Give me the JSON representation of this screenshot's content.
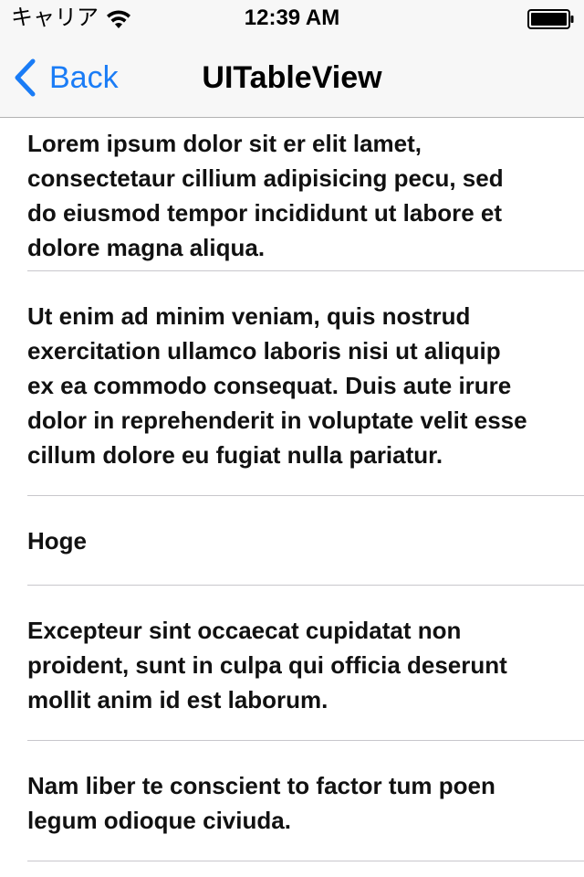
{
  "status_bar": {
    "carrier": "キャリア",
    "time": "12:39 AM",
    "wifi_icon": "wifi-icon",
    "battery_icon": "battery-full-icon"
  },
  "nav": {
    "back_label": "Back",
    "back_icon": "chevron-left-icon",
    "title": "UITableView",
    "tint_color": "#1a7cf6"
  },
  "table": {
    "rows": [
      {
        "text": "Lorem ipsum dolor sit er elit lamet,\nconsectetaur cillium adipisicing pecu, sed\ndo eiusmod tempor incididunt ut labore et\ndolore magna aliqua."
      },
      {
        "text": "Ut enim ad minim veniam, quis nostrud\nexercitation ullamco laboris nisi ut aliquip\nex ea commodo consequat. Duis aute irure\ndolor in reprehenderit in voluptate velit esse\ncillum dolore eu fugiat nulla pariatur."
      },
      {
        "text": "Hoge"
      },
      {
        "text": "Excepteur sint occaecat cupidatat non\nproident, sunt in culpa qui officia deserunt\nmollit anim id est laborum."
      },
      {
        "text": "Nam liber te conscient to factor tum poen\nlegum odioque civiuda."
      }
    ]
  }
}
